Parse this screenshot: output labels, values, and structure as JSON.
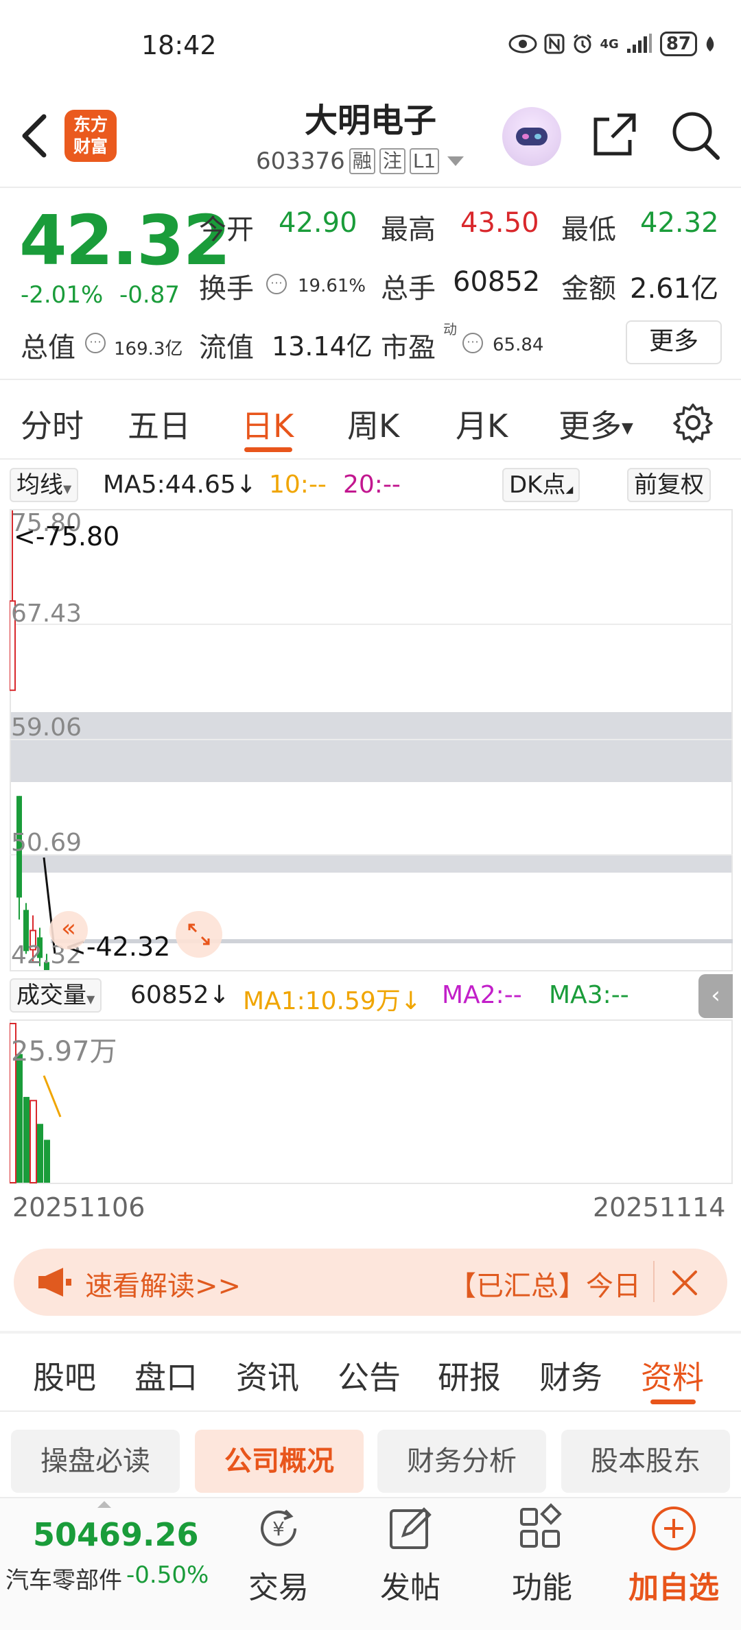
{
  "status": {
    "time": "18:42",
    "network": "4G",
    "battery": "87"
  },
  "header": {
    "logo_line1": "东方",
    "logo_line2": "财富",
    "name": "大明电子",
    "code": "603376",
    "tags": [
      "融",
      "注",
      "L1"
    ]
  },
  "quote": {
    "price": "42.32",
    "change_pct": "-2.01%",
    "change_val": "-0.87",
    "open_label": "今开",
    "open": "42.90",
    "high_label": "最高",
    "high": "43.50",
    "low_label": "最低",
    "low": "42.32",
    "turnover_label": "换手",
    "turnover": "19.61%",
    "volume_label": "总手",
    "volume": "60852",
    "amount_label": "金额",
    "amount": "2.61亿",
    "mcap_label": "总值",
    "mcap": "169.3亿",
    "float_label": "流值",
    "float": "13.14亿",
    "pe_label": "市盈",
    "pe_sup": "动",
    "pe": "65.84",
    "more": "更多"
  },
  "period_tabs": [
    "分时",
    "五日",
    "日K",
    "周K",
    "月K",
    "更多"
  ],
  "chart_toolbar": {
    "ma_select": "均线",
    "ma5": "MA5:44.65",
    "ma5_arrow": "↓",
    "ma10": "10:--",
    "ma20": "20:--",
    "dk": "DK点",
    "adjust": "前复权"
  },
  "chart_data": {
    "type": "candlestick",
    "y_ticks": [
      "75.80",
      "67.43",
      "59.06",
      "50.69",
      "42.32"
    ],
    "max_marker": "<-75.80",
    "min_marker": "<-42.32",
    "x_start": "20251106",
    "x_end": "20251114",
    "ylim": [
      42.32,
      75.8
    ],
    "candles": [
      {
        "open": 62.7,
        "close": 69.2,
        "high": 75.8,
        "low": 62.7,
        "color": "red"
      },
      {
        "open": 55.0,
        "close": 47.6,
        "high": 55.0,
        "low": 46.0,
        "color": "green"
      },
      {
        "open": 46.7,
        "close": 43.7,
        "high": 47.2,
        "low": 43.5,
        "color": "green"
      },
      {
        "open": 43.8,
        "close": 45.2,
        "high": 46.3,
        "low": 42.9,
        "color": "red"
      },
      {
        "open": 44.7,
        "close": 43.2,
        "high": 45.4,
        "low": 42.6,
        "color": "green"
      },
      {
        "open": 42.9,
        "close": 42.32,
        "high": 43.5,
        "low": 42.32,
        "color": "green"
      }
    ],
    "volume": {
      "label": "成交量",
      "current": "60852",
      "current_arrow": "↓",
      "ma1": "MA1:10.59万",
      "ma1_arrow": "↓",
      "ma2": "MA2:--",
      "ma3": "MA3:--",
      "max_label": "25.97万",
      "max": 25.97,
      "values": [
        25.97,
        21.0,
        14.0,
        13.4,
        9.6,
        7.0
      ],
      "colors": [
        "red",
        "green",
        "green",
        "red",
        "green",
        "green"
      ]
    }
  },
  "banner": {
    "left_text": "速看解读>>",
    "right_text": "【已汇总】今日"
  },
  "info_tabs": [
    "股吧",
    "盘口",
    "资讯",
    "公告",
    "研报",
    "财务",
    "资料"
  ],
  "sub_tabs": [
    "操盘必读",
    "公司概况",
    "财务分析",
    "股本股东"
  ],
  "bottom": {
    "index_value": "50469.26",
    "index_name": "汽车零部件",
    "index_change": "-0.50%",
    "buttons": [
      "交易",
      "发帖",
      "功能",
      "加自选"
    ]
  },
  "colors": {
    "up": "#d9282c",
    "down": "#1a9c3a",
    "accent": "#e8551b"
  }
}
